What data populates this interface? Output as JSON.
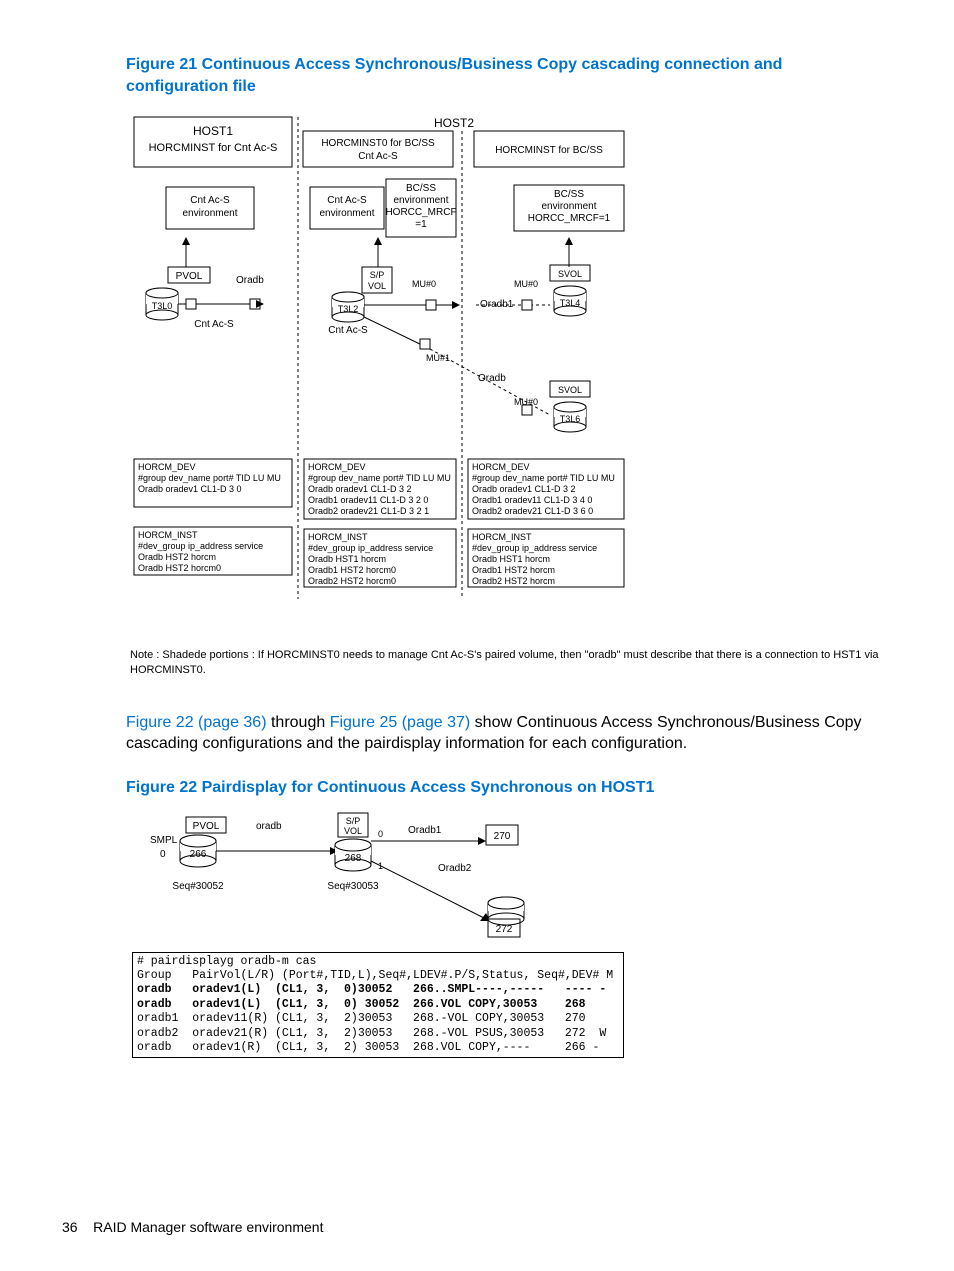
{
  "figure21": {
    "title": "Figure 21 Continuous Access Synchronous/Business Copy cascading connection and configuration file",
    "host1_label": "HOST1",
    "host1_sub": "HORCMINST for Cnt Ac-S",
    "host2_label": "HOST2",
    "host2_h0": "HORCMINST0 for BC/SS\nCnt Ac-S",
    "host2_h1": "HORCMINST for BC/SS",
    "env_cntacs": "Cnt Ac-S\nenvironment",
    "env_bcss": "BC/SS\nenvironment\nHORCC_MRCF\n=1",
    "env_bcss2": "BC/SS\nenvironment\nHORCC_MRCF=1",
    "pvol": "PVOL",
    "svol": "SVOL",
    "spvol": "S/P\nVOL",
    "t3l0": "T3L0",
    "t3l2": "T3L2",
    "t3l4": "T3L4",
    "t3l6": "T3L6",
    "mu0": "MU#0",
    "mu1": "MU#1",
    "oradb": "Oradb",
    "oradb1": "Oradb1",
    "cnt_acs": "Cnt Ac-S",
    "dev1_header": "HORCM_DEV",
    "dev1_cols": "#group dev_name port# TID LU MU",
    "dev1_row1": "Oradb  oradev1 CL1-D 3 0",
    "dev2_row1": "Oradb  oradev1  CL1-D 3 2",
    "dev2_row2": "Oradb1 oradev11 CL1-D 3 2 0",
    "dev2_row3": "Oradb2 oradev21 CL1-D 3 2 1",
    "dev3_row1": "Oradb  oradev1  CL1-D 3 2",
    "dev3_row2": "Oradb1 oradev11 CL1-D 3 4 0",
    "dev3_row3": "Oradb2 oradev21 CL1-D 3 6 0",
    "inst_header": "HORCM_INST",
    "inst_cols": "#dev_group  ip_address  service",
    "inst1_r1": "Oradb     HST2     horcm",
    "inst1_r2": "Oradb     HST2     horcm0",
    "inst2_r1": "Oradb     HST1     horcm",
    "inst2_r2": "Oradb1    HST2     horcm0",
    "inst2_r3": "Oradb2    HST2     horcm0",
    "inst3_r1": "Oradb     HST1     horcm",
    "inst3_r2": "Oradb1    HST2     horcm",
    "inst3_r3": "Oradb2    HST2     horcm",
    "note": "Note : Shadede portions : If HORCMINST0 needs to manage Cnt Ac-S's paired volume, then \"oradb\" must describe that there is a connection to HST1 via HORCMINST0."
  },
  "midpara": {
    "link1": "Figure 22 (page 36)",
    "mid1": " through ",
    "link2": "Figure 25 (page 37)",
    "rest": " show Continuous Access Synchronous/Business Copy cascading configurations and the pairdisplay information for each configuration."
  },
  "figure22": {
    "title": "Figure 22 Pairdisplay for Continuous Access Synchronous on HOST1",
    "pvol": "PVOL",
    "oradb": "oradb",
    "spvol": "S/P\nVOL",
    "oradb1": "Oradb1",
    "oradb2": "Oradb2",
    "smpl": "SMPL",
    "v266": "266",
    "v268": "268",
    "v270": "270",
    "v272": "272",
    "zero0": "0",
    "one1": "1",
    "seq1": "Seq#30052",
    "seq2": "Seq#30053",
    "code": {
      "l1": "# pairdisplayg oradb-m cas",
      "l2": "Group   PairVol(L/R) (Port#,TID,L),Seq#,LDEV#.P/S,Status, Seq#,DEV# M",
      "l3": "oradb   oradev1(L)  (CL1, 3,  0)30052   266..SMPL----,-----   ---- -",
      "l4": "oradb   oradev1(L)  (CL1, 3,  0) 30052  266.VOL COPY,30053    268",
      "l5": "oradb1  oradev11(R) (CL1, 3,  2)30053   268.-VOL COPY,30053   270",
      "l6": "oradb2  oradev21(R) (CL1, 3,  2)30053   268.-VOL PSUS,30053   272  W",
      "l7": "oradb   oradev1(R)  (CL1, 3,  2) 30053  268.VOL COPY,----     266 -"
    }
  },
  "footer": {
    "pageno": "36",
    "title": "RAID Manager software environment"
  }
}
